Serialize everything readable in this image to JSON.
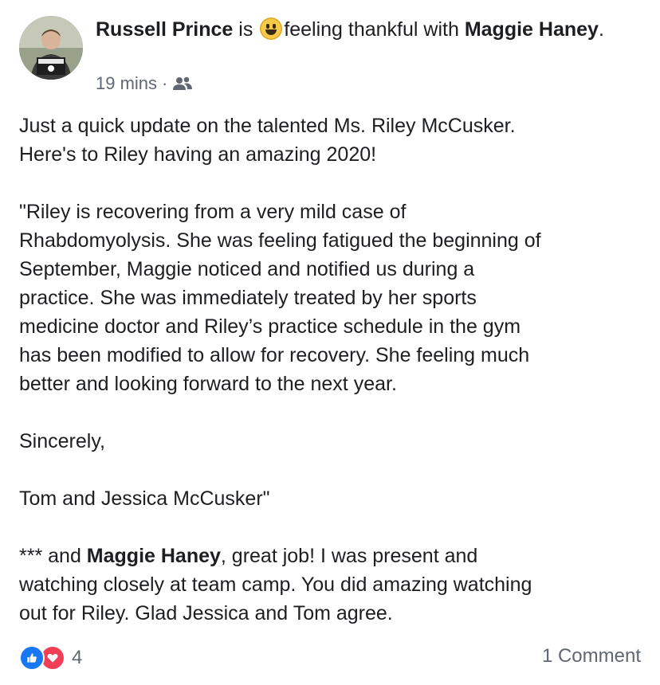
{
  "post": {
    "author": "Russell Prince",
    "is": "is",
    "feeling": "feeling thankful with",
    "tagged": "Maggie Haney",
    "period": ".",
    "time": "19 mins",
    "separator": "·",
    "privacy_icon": "friends-icon"
  },
  "content": {
    "paragraph1": "Just a quick update on the talented Ms. Riley McCusker.\nHere's to Riley having an amazing 2020!",
    "paragraph2": "\"Riley is recovering from a very mild case of\nRhabdomyolysis. She was feeling fatigued the beginning of\nSeptember, Maggie noticed and notified us during a\npractice. She was immediately treated by her sports\nmedicine doctor and Riley’s practice schedule in the gym\nhas been modified to allow for recovery. She feeling much\nbetter and looking forward to the next year.",
    "paragraph3": "Sincerely,",
    "paragraph4": "Tom and Jessica McCusker\"",
    "p5_prefix": "*** and ",
    "p5_name": "Maggie Haney",
    "p5_rest": ", great job! I was present and\nwatching closely at team camp. You did amazing watching\nout for Riley. Glad Jessica and Tom agree."
  },
  "footer": {
    "reaction_count": "4",
    "comments": "1 Comment"
  },
  "colors": {
    "like": "#1877f2",
    "love": "#f33e58",
    "meta": "#606770",
    "text": "#1c1e21"
  }
}
